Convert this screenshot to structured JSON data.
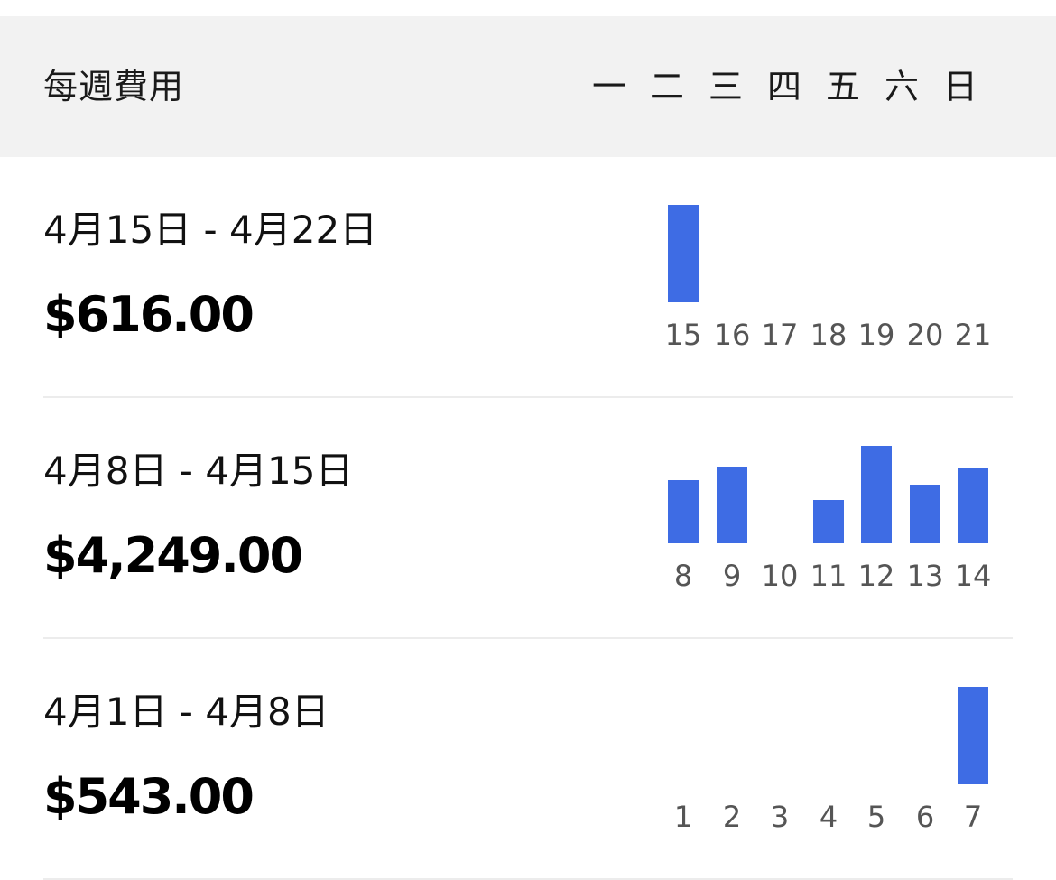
{
  "header": {
    "title": "每週費用",
    "weekdays": [
      "一",
      "二",
      "三",
      "四",
      "五",
      "六",
      "日"
    ]
  },
  "colors": {
    "bar": "#3e6ce4",
    "header_bg": "#f2f2f2",
    "divider": "#ececec"
  },
  "weeks": [
    {
      "range": "4月15日 - 4月22日",
      "amount": "$616.00",
      "days": [
        "15",
        "16",
        "17",
        "18",
        "19",
        "20",
        "21"
      ],
      "bar_levels": [
        1.0,
        0,
        0,
        0,
        0,
        0,
        0
      ]
    },
    {
      "range": "4月8日 - 4月15日",
      "amount": "$4,249.00",
      "days": [
        "8",
        "9",
        "10",
        "11",
        "12",
        "13",
        "14"
      ],
      "bar_levels": [
        0.65,
        0.79,
        0,
        0.44,
        1.0,
        0.6,
        0.78
      ]
    },
    {
      "range": "4月1日 - 4月8日",
      "amount": "$543.00",
      "days": [
        "1",
        "2",
        "3",
        "4",
        "5",
        "6",
        "7"
      ],
      "bar_levels": [
        0,
        0,
        0,
        0,
        0,
        0,
        1.0
      ]
    }
  ]
}
